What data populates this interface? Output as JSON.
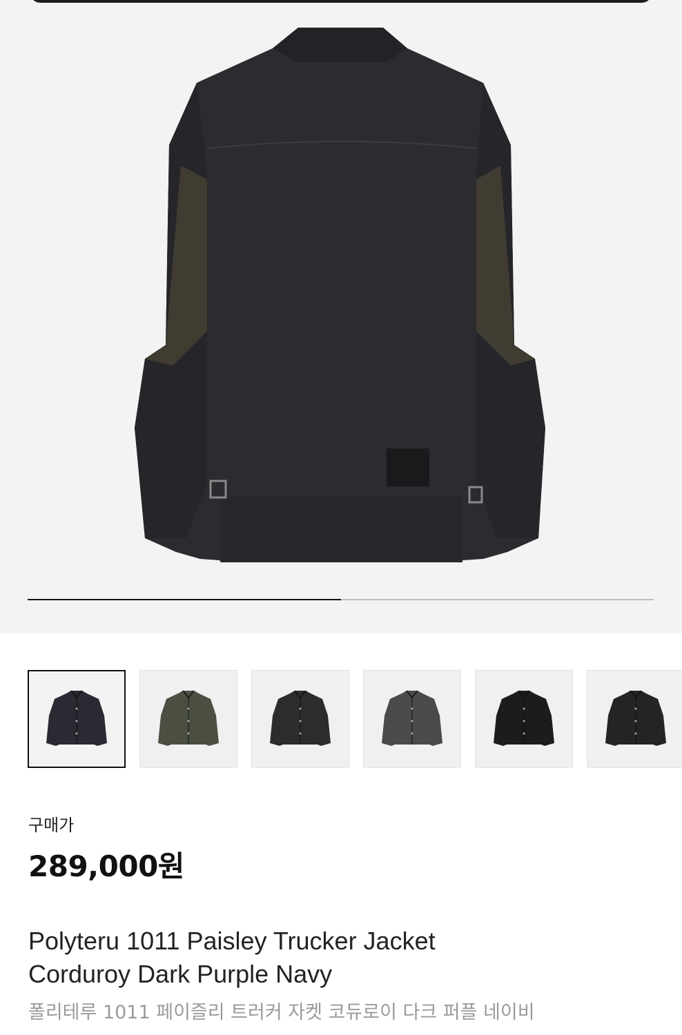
{
  "gallery": {
    "main_image_alt": "Polyteru 1011 Paisley Trucker Jacket back view",
    "slide_progress": 0.5,
    "selected_thumb": 0,
    "thumbnails": [
      {
        "name": "thumb-1",
        "color": "#2a2a33"
      },
      {
        "name": "thumb-2",
        "color": "#4a4f42"
      },
      {
        "name": "thumb-3",
        "color": "#2c2c2e"
      },
      {
        "name": "thumb-4",
        "color": "#4c4a48"
      },
      {
        "name": "thumb-5",
        "color": "#1c1c1e"
      },
      {
        "name": "thumb-6",
        "color": "#242426"
      }
    ]
  },
  "product": {
    "price_label": "구매가",
    "price": "289,000원",
    "title_line1": "Polyteru 1011 Paisley Trucker Jacket",
    "title_line2": "Corduroy Dark Purple Navy",
    "subtitle": "폴리테루 1011 페이즐리 트러커 자켓 코듀로이 다크 퍼플 네이비"
  },
  "colors": {
    "hero_bg": "#f3f3f3",
    "jacket": "#2b2a2e",
    "paisley": "#4a4436"
  }
}
